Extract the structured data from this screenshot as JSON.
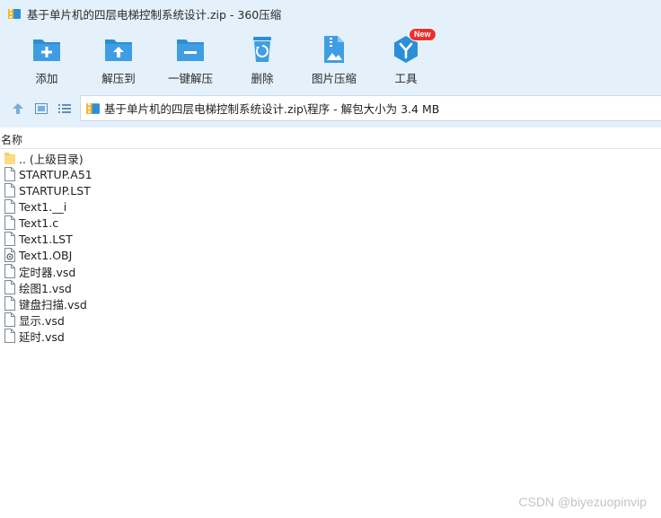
{
  "window": {
    "title": "基于单片机的四层电梯控制系统设计.zip - 360压缩"
  },
  "toolbar": {
    "add_label": "添加",
    "extract_to_label": "解压到",
    "one_click_extract_label": "一键解压",
    "delete_label": "删除",
    "image_compress_label": "图片压缩",
    "tools_label": "工具",
    "tools_badge": "New"
  },
  "address": {
    "path": "基于单片机的四层电梯控制系统设计.zip\\程序 - 解包大小为 3.4 MB"
  },
  "list": {
    "column_name": "名称",
    "items": [
      {
        "name": ".. (上级目录)",
        "icon": "folder-icon"
      },
      {
        "name": "STARTUP.A51",
        "icon": "file-icon"
      },
      {
        "name": "STARTUP.LST",
        "icon": "file-icon"
      },
      {
        "name": "Text1.__i",
        "icon": "file-icon"
      },
      {
        "name": "Text1.c",
        "icon": "file-icon"
      },
      {
        "name": "Text1.LST",
        "icon": "file-icon"
      },
      {
        "name": "Text1.OBJ",
        "icon": "obj-file-icon"
      },
      {
        "name": "定时器.vsd",
        "icon": "file-icon"
      },
      {
        "name": "绘图1.vsd",
        "icon": "file-icon"
      },
      {
        "name": "键盘扫描.vsd",
        "icon": "file-icon"
      },
      {
        "name": "显示.vsd",
        "icon": "file-icon"
      },
      {
        "name": "延时.vsd",
        "icon": "file-icon"
      }
    ]
  },
  "watermark": "CSDN @biyezuopinvip",
  "colors": {
    "chrome_background": "#e4f1fb",
    "icon_blue": "#2b8fd8",
    "badge_red": "#e8312f",
    "folder_yellow": "#f5cf68"
  }
}
